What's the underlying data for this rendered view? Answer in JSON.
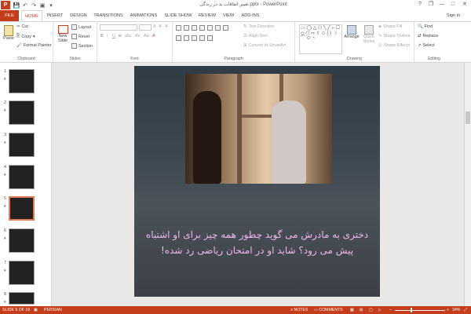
{
  "app": {
    "title": "تغییر اتفاقات بد در زندگی.pptx - PowerPoint",
    "logo_text": "P",
    "sign_in": "Sign in"
  },
  "qat": {
    "save_icon": "save-icon",
    "undo_icon": "undo-icon",
    "redo_icon": "redo-icon",
    "start_icon": "start-from-beginning-icon",
    "customize_icon": "customize-qat-icon"
  },
  "window": {
    "help": "?",
    "restore": "❐",
    "minimize": "—",
    "maximize": "□",
    "close": "✕"
  },
  "tabs": [
    "FILE",
    "HOME",
    "INSERT",
    "DESIGN",
    "TRANSITIONS",
    "ANIMATIONS",
    "SLIDE SHOW",
    "REVIEW",
    "VIEW",
    "ADD-INS"
  ],
  "active_tab": "HOME",
  "ribbon": {
    "clipboard": {
      "label": "Clipboard",
      "paste": "Paste",
      "cut": "Cut",
      "copy": "Copy",
      "format_painter": "Format Painter"
    },
    "slides": {
      "label": "Slides",
      "new_slide": "New Slide",
      "layout": "Layout",
      "reset": "Reset",
      "section": "Section"
    },
    "font": {
      "label": "Font",
      "bold": "B",
      "italic": "I",
      "underline": "U",
      "strike": "S",
      "shadow": "abc",
      "spacing": "AV",
      "case": "Aa",
      "color": "A",
      "grow": "A",
      "shrink": "A",
      "clear": "A"
    },
    "paragraph": {
      "label": "Paragraph",
      "text_direction": "Text Direction",
      "align_text": "Align Text",
      "convert_smartart": "Convert to SmartArt"
    },
    "drawing": {
      "label": "Drawing",
      "shapes_glyphs": "▭ ◯ △ ⬠ ╲ ╱ ⌐ ☐ ◇ ⬡ ⇨ ⇧ ✩ { } ☽ ⌒ ⬭ ◔",
      "arrange": "Arrange",
      "quick_styles": "Quick Styles",
      "shape_fill": "Shape Fill",
      "shape_outline": "Shape Outline",
      "shape_effects": "Shape Effects"
    },
    "editing": {
      "label": "Editing",
      "find": "Find",
      "replace": "Replace",
      "select": "Select"
    }
  },
  "thumbnails": [
    {
      "num": "1",
      "star": "★"
    },
    {
      "num": "2",
      "star": "★"
    },
    {
      "num": "3",
      "star": "★"
    },
    {
      "num": "4",
      "star": "★"
    },
    {
      "num": "5",
      "star": "★",
      "selected": true
    },
    {
      "num": "6",
      "star": "★"
    },
    {
      "num": "7",
      "star": "★"
    },
    {
      "num": "8",
      "star": "★"
    }
  ],
  "slide": {
    "caption_line1": "دختری به مادرش می گوید چطور همه چیز برای او اشتباه",
    "caption_line2": "پیش می رود؟ شاید او در امتحان ریاضی رد شده!",
    "caption_color": "#f0b6ec"
  },
  "status": {
    "slide_info": "SLIDE 5 OF 19",
    "language": "PERSIAN",
    "notes": "NOTES",
    "comments": "COMMENTS",
    "zoom": "34%"
  },
  "colors": {
    "accent": "#c43e1c"
  }
}
